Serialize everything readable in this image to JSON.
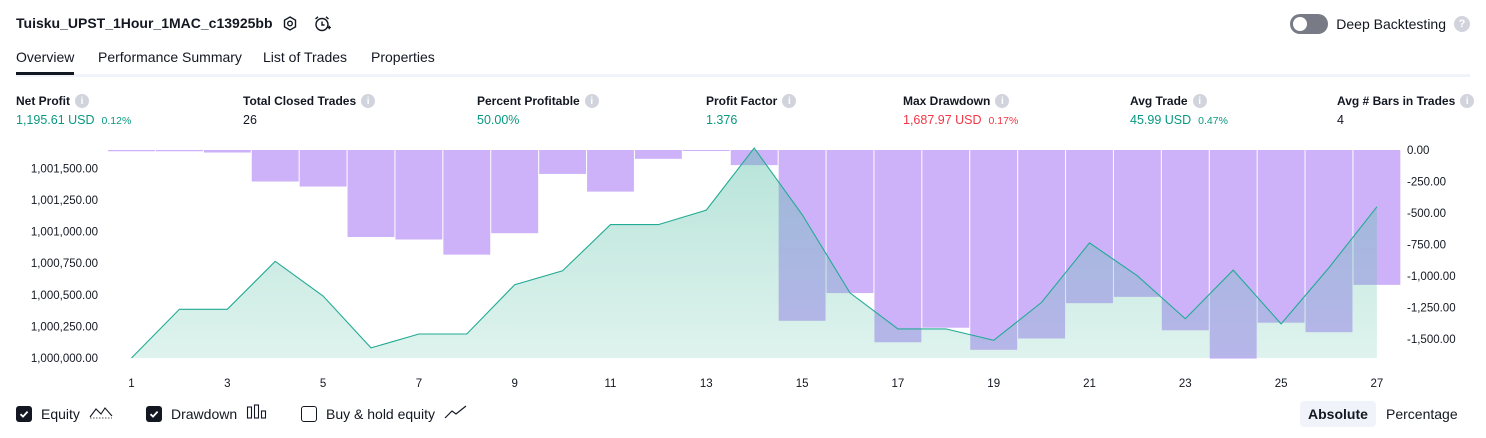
{
  "header": {
    "title": "Tuisku_UPST_1Hour_1MAC_c13925bb",
    "deep_backtesting_label": "Deep Backtesting"
  },
  "tabs": [
    {
      "label": "Overview",
      "active": true
    },
    {
      "label": "Performance Summary",
      "active": false
    },
    {
      "label": "List of Trades",
      "active": false
    },
    {
      "label": "Properties",
      "active": false
    }
  ],
  "stats": [
    {
      "label": "Net Profit",
      "value": "1,195.61 USD",
      "pct": "0.12%",
      "color": "green"
    },
    {
      "label": "Total Closed Trades",
      "value": "26",
      "pct": "",
      "color": "dark"
    },
    {
      "label": "Percent Profitable",
      "value": "50.00%",
      "pct": "",
      "color": "green"
    },
    {
      "label": "Profit Factor",
      "value": "1.376",
      "pct": "",
      "color": "green"
    },
    {
      "label": "Max Drawdown",
      "value": "1,687.97 USD",
      "pct": "0.17%",
      "color": "red"
    },
    {
      "label": "Avg Trade",
      "value": "45.99 USD",
      "pct": "0.47%",
      "color": "green"
    },
    {
      "label": "Avg # Bars in Trades",
      "value": "4",
      "pct": "",
      "color": "dark"
    }
  ],
  "chart_data": {
    "type": "line",
    "x_ticks": [
      "1",
      "3",
      "5",
      "7",
      "9",
      "11",
      "13",
      "15",
      "17",
      "19",
      "21",
      "23",
      "25",
      "27"
    ],
    "left_axis": {
      "ticks": [
        "1,000,000.00",
        "1,000,250.00",
        "1,000,500.00",
        "1,000,750.00",
        "1,001,000.00",
        "1,001,250.00",
        "1,001,500.00"
      ],
      "range": [
        1000000,
        1001645
      ]
    },
    "right_axis": {
      "ticks": [
        "0.00",
        "-250.00",
        "-500.00",
        "-750.00",
        "-1,000.00",
        "-1,250.00",
        "-1,500.00"
      ],
      "range": [
        -1650,
        0
      ]
    },
    "series": [
      {
        "name": "Equity",
        "type": "area",
        "color": "#22ab94",
        "x": [
          1,
          2,
          3,
          4,
          5,
          6,
          7,
          8,
          9,
          10,
          11,
          12,
          13,
          14,
          15,
          16,
          17,
          18,
          19,
          20,
          21,
          22,
          23,
          24,
          25,
          26,
          27
        ],
        "values": [
          1000000,
          1000385,
          1000385,
          1000765,
          1000490,
          1000080,
          1000190,
          1000190,
          1000580,
          1000690,
          1001055,
          1001055,
          1001170,
          1001660,
          1001135,
          1000515,
          1000230,
          1000230,
          1000140,
          1000440,
          1000910,
          1000650,
          1000310,
          1000695,
          1000270,
          1000715,
          1001195.61
        ]
      },
      {
        "name": "Drawdown",
        "type": "bar",
        "color": "#c4a4f9",
        "x": [
          1,
          2,
          3,
          4,
          5,
          6,
          7,
          8,
          9,
          10,
          11,
          12,
          13,
          14,
          15,
          16,
          17,
          18,
          19,
          20,
          21,
          22,
          23,
          24,
          25,
          26,
          27
        ],
        "values": [
          -10,
          -10,
          -20,
          -250,
          -290,
          -690,
          -710,
          -830,
          -660,
          -190,
          -330,
          -70,
          -5,
          -120,
          -1355,
          -1135,
          -1525,
          -1410,
          -1585,
          -1495,
          -1215,
          -1165,
          -1430,
          -1655,
          -1370,
          -1445,
          -1070
        ]
      }
    ]
  },
  "legend": [
    {
      "label": "Equity",
      "checked": true,
      "icon": "equity-line-icon"
    },
    {
      "label": "Drawdown",
      "checked": true,
      "icon": "drawdown-bars-icon"
    },
    {
      "label": "Buy & hold equity",
      "checked": false,
      "icon": "buy-hold-line-icon"
    }
  ],
  "mode_toggle": {
    "absolute_label": "Absolute",
    "percentage_label": "Percentage",
    "selected": "Absolute"
  }
}
